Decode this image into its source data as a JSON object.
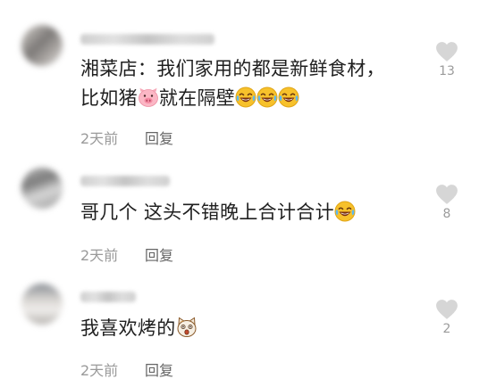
{
  "comments": [
    {
      "line1": "湘菜店：我们家用的都是新鲜食材，",
      "line2_before": "比如猪",
      "line2_after": "就在隔壁",
      "time": "2天前",
      "reply": "回复",
      "likes": "13",
      "emoji": [
        "pig-face-icon",
        "rolling-laughing-icon",
        "rolling-laughing-icon",
        "rolling-laughing-icon"
      ]
    },
    {
      "text": "哥几个 这头不错晚上合计合计",
      "time": "2天前",
      "reply": "回复",
      "likes": "8",
      "emoji": [
        "rolling-laughing-icon"
      ]
    },
    {
      "text": "我喜欢烤的",
      "time": "2天前",
      "reply": "回复",
      "likes": "2",
      "emoji": [
        "shocked-cat-icon"
      ]
    }
  ],
  "colors": {
    "text": "#1f1f1f",
    "meta": "#9a9a9a",
    "reply": "#666666",
    "heart": "#d6d6d6",
    "count": "#9b9b9b"
  }
}
